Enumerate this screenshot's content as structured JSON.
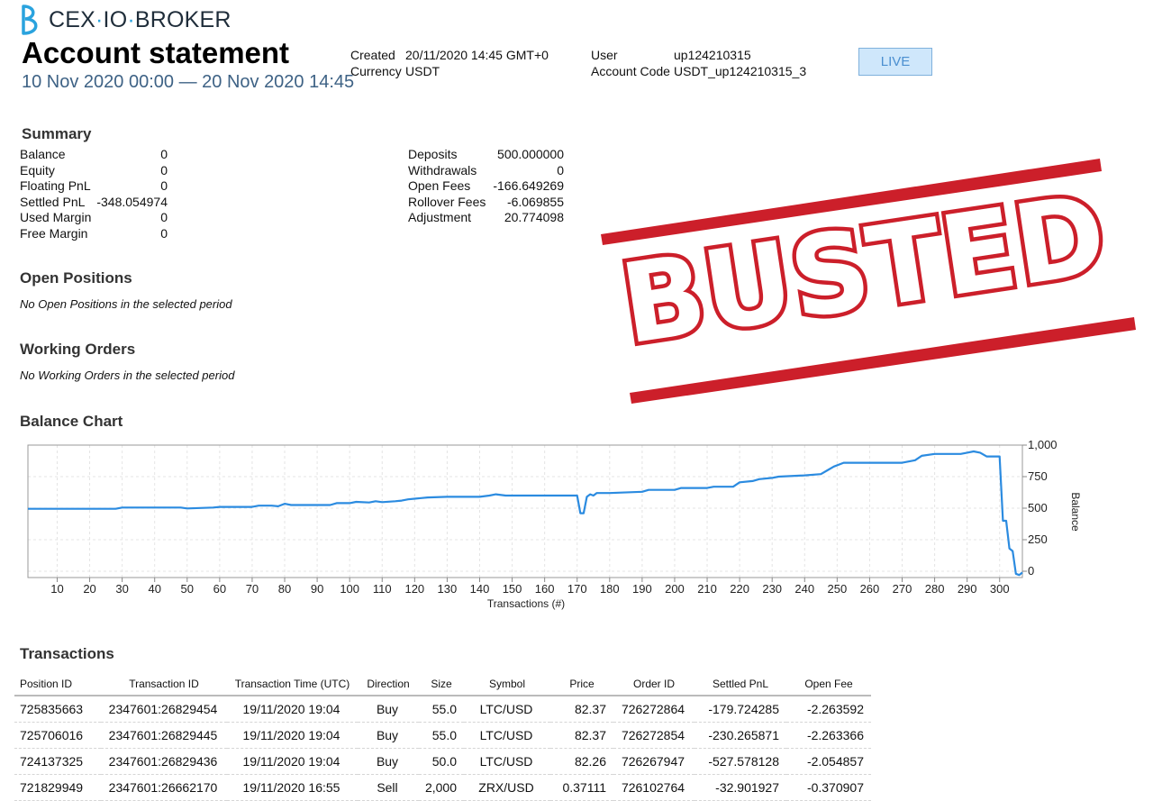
{
  "header": {
    "brand_left": "CEX",
    "brand_mid": "IO",
    "brand_right": "BROKER",
    "title": "Account statement",
    "period": "10 Nov 2020 00:00 — 20 Nov 2020 14:45",
    "created_label": "Created",
    "created_value": "20/11/2020 14:45 GMT+0",
    "currency_label": "Currency",
    "currency_value": "USDT",
    "user_label": "User",
    "user_value": "up124210315",
    "account_code_label": "Account Code",
    "account_code_value": "USDT_up124210315_3",
    "live_label": "LIVE"
  },
  "summary": {
    "heading": "Summary",
    "left": [
      {
        "label": "Balance",
        "value": "0"
      },
      {
        "label": "Equity",
        "value": "0"
      },
      {
        "label": "Floating PnL",
        "value": "0"
      },
      {
        "label": "Settled PnL",
        "value": "-348.054974"
      },
      {
        "label": "Used Margin",
        "value": "0"
      },
      {
        "label": "Free Margin",
        "value": "0"
      }
    ],
    "right": [
      {
        "label": "Deposits",
        "value": "500.000000"
      },
      {
        "label": "Withdrawals",
        "value": "0"
      },
      {
        "label": "Open Fees",
        "value": "-166.649269"
      },
      {
        "label": "Rollover Fees",
        "value": "-6.069855"
      },
      {
        "label": "Adjustment",
        "value": "20.774098"
      }
    ]
  },
  "open_positions": {
    "heading": "Open Positions",
    "note": "No Open Positions in the selected period"
  },
  "working_orders": {
    "heading": "Working Orders",
    "note": "No Working Orders in the selected period"
  },
  "stamp": {
    "text": "BUSTED",
    "color": "#cc1f2a"
  },
  "balance_chart": {
    "heading": "Balance Chart",
    "line_color": "#2b8be0"
  },
  "chart_data": {
    "type": "line",
    "title": "",
    "xlabel": "Transactions (#)",
    "ylabel": "Balance",
    "xlim": [
      1,
      307
    ],
    "ylim": [
      -50,
      1000
    ],
    "x_ticks": [
      10,
      20,
      30,
      40,
      50,
      60,
      70,
      80,
      90,
      100,
      110,
      120,
      130,
      140,
      150,
      160,
      170,
      180,
      190,
      200,
      210,
      220,
      230,
      240,
      250,
      260,
      270,
      280,
      290,
      300
    ],
    "y_ticks": [
      0,
      250,
      500,
      750,
      1000
    ],
    "y_tick_labels": [
      "0",
      "250",
      "500",
      "750",
      "1,000"
    ],
    "grid": true,
    "series": [
      {
        "x": [
          1,
          28,
          30,
          48,
          50,
          58,
          60,
          70,
          72,
          76,
          78,
          80,
          82,
          94,
          96,
          100,
          102,
          106,
          108,
          110,
          114,
          116,
          118,
          120,
          122,
          124,
          130,
          140,
          143,
          145,
          148,
          150,
          160,
          170,
          171,
          172,
          173,
          174,
          175,
          176,
          180,
          190,
          192,
          200,
          202,
          210,
          212,
          218,
          220,
          224,
          226,
          230,
          232,
          240,
          245,
          247,
          249,
          252,
          260,
          270,
          272,
          274,
          276,
          280,
          288,
          290,
          292,
          294,
          296,
          300,
          301,
          302,
          303,
          304,
          305,
          306,
          307
        ],
        "y": [
          495,
          495,
          505,
          505,
          498,
          505,
          510,
          510,
          520,
          520,
          515,
          535,
          525,
          525,
          540,
          540,
          550,
          545,
          555,
          548,
          555,
          560,
          570,
          575,
          580,
          585,
          590,
          590,
          600,
          610,
          600,
          600,
          600,
          600,
          460,
          460,
          590,
          610,
          600,
          620,
          620,
          630,
          645,
          645,
          660,
          660,
          670,
          670,
          705,
          715,
          730,
          740,
          750,
          760,
          770,
          800,
          830,
          860,
          860,
          860,
          870,
          880,
          915,
          930,
          930,
          940,
          950,
          940,
          910,
          910,
          400,
          400,
          180,
          160,
          -20,
          -30,
          -10
        ]
      }
    ]
  },
  "transactions": {
    "heading": "Transactions",
    "columns": [
      "Position ID",
      "Transaction ID",
      "Transaction Time (UTC)",
      "Direction",
      "Size",
      "Symbol",
      "Price",
      "Order ID",
      "Settled PnL",
      "Open Fee"
    ],
    "rows": [
      [
        "725835663",
        "2347601:26829454",
        "19/11/2020 19:04",
        "Buy",
        "55.0",
        "LTC/USD",
        "82.37",
        "726272864",
        "-179.724285",
        "-2.263592"
      ],
      [
        "725706016",
        "2347601:26829445",
        "19/11/2020 19:04",
        "Buy",
        "55.0",
        "LTC/USD",
        "82.37",
        "726272854",
        "-230.265871",
        "-2.263366"
      ],
      [
        "724137325",
        "2347601:26829436",
        "19/11/2020 19:04",
        "Buy",
        "50.0",
        "LTC/USD",
        "82.26",
        "726267947",
        "-527.578128",
        "-2.054857"
      ],
      [
        "721829949",
        "2347601:26662170",
        "19/11/2020 16:55",
        "Sell",
        "2,000",
        "ZRX/USD",
        "0.37111",
        "726102764",
        "-32.901927",
        "-0.370907"
      ]
    ]
  }
}
